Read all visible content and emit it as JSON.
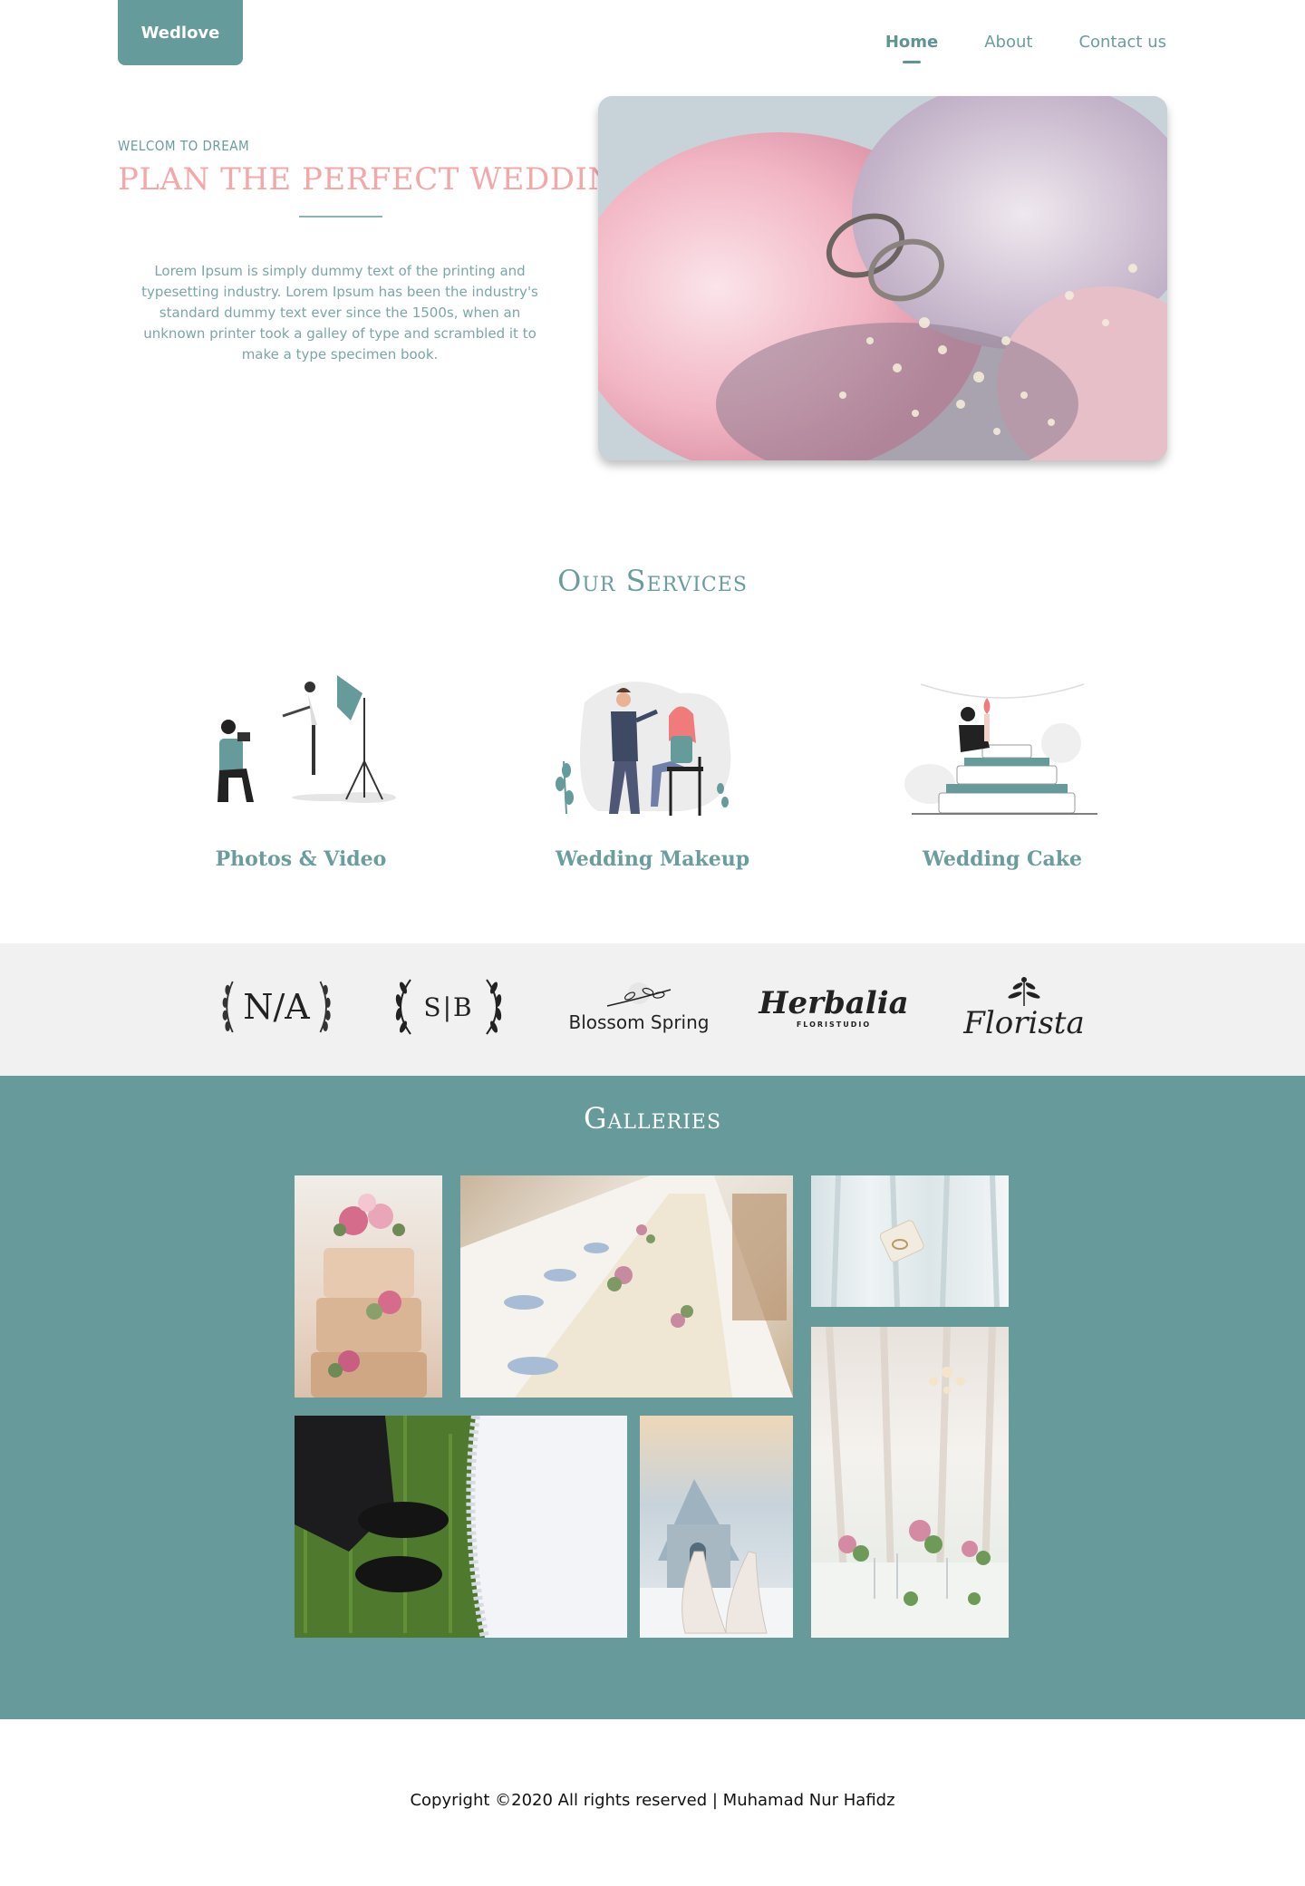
{
  "header": {
    "logo": "Wedlove",
    "nav": [
      {
        "label": "Home",
        "active": true
      },
      {
        "label": "About",
        "active": false
      },
      {
        "label": "Contact us",
        "active": false
      }
    ]
  },
  "hero": {
    "subtitle": "WELCOM TO DREAM",
    "title": "PLAN THE PERFECT WEDDING",
    "text": "Lorem Ipsum is simply dummy text of the printing and typesetting industry. Lorem Ipsum has been the industry's standard dummy text ever since the 1500s, when an unknown printer took a galley of type and scrambled it to make a type specimen book."
  },
  "services": {
    "title": "Our Services",
    "items": [
      {
        "label": "Photos & Video"
      },
      {
        "label": "Wedding Makeup"
      },
      {
        "label": "Wedding Cake"
      }
    ]
  },
  "brands": {
    "items": [
      "N/A",
      "S|B",
      "Blossom Spring",
      "Herbalia",
      "FLORISTUDIO",
      "Florista"
    ]
  },
  "galleries": {
    "title": "Galleries"
  },
  "footer": {
    "copyright": "Copyright ©2020 All rights reserved | Muhamad Nur Hafidz"
  },
  "colors": {
    "accent": "#669b9b",
    "title_pink": "#f4a7a7",
    "brands_bg": "#f1f1f1"
  }
}
